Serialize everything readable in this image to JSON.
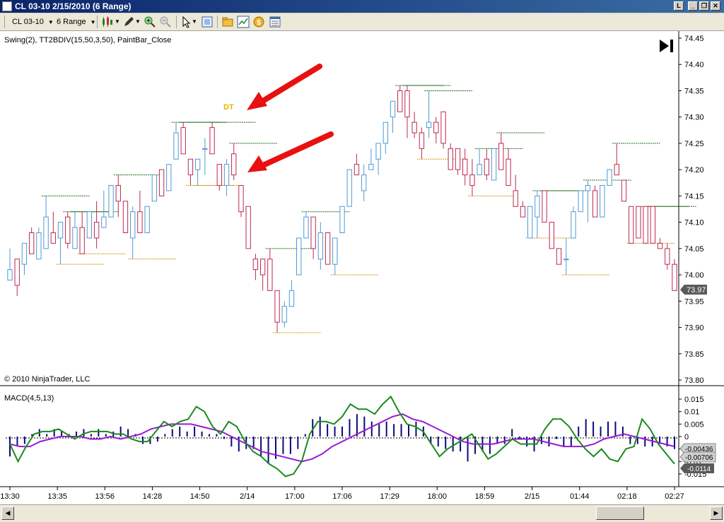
{
  "window": {
    "title": "CL 03-10  2/15/2010 (6 Range)"
  },
  "toolbar": {
    "instrument": "CL 03-10",
    "interval": "6 Range"
  },
  "chart": {
    "indicator_label": "Swing(2), TT2BDIV(15,50,3,50), PaintBar_Close",
    "signal_label": "DT",
    "copyright": "© 2010 NinjaTrader, LLC",
    "last_price": "73.97",
    "macd_label": "MACD(4,5,13)",
    "macd_values": [
      "-0.00436",
      "-0.00706",
      "-0.0114"
    ],
    "price_ticks": [
      "74.45",
      "74.40",
      "74.35",
      "74.30",
      "74.25",
      "74.20",
      "74.15",
      "74.10",
      "74.05",
      "74.00",
      "73.95",
      "73.90",
      "73.85",
      "73.80"
    ],
    "macd_ticks": [
      "0.015",
      "0.01",
      "0.005",
      "0",
      "-0.005",
      "-0.01",
      "-0.015"
    ],
    "time_ticks": [
      "13:30",
      "13:35",
      "13:56",
      "14:28",
      "14:50",
      "2/14",
      "17:00",
      "17:06",
      "17:29",
      "18:00",
      "18:59",
      "2/15",
      "01:44",
      "02:18",
      "02:27"
    ],
    "colors": {
      "up": "#4e9ad4",
      "down": "#c0284e",
      "macd": "#1a8a1a",
      "signal": "#9a1ad4",
      "hist": "#0a0a7a",
      "swing_high": "#1a6a1a",
      "swing_low": "#d49a1a",
      "arrow": "#e81010"
    }
  },
  "chart_data": [
    {
      "type": "candlestick",
      "title": "",
      "ylim": [
        73.8,
        74.45
      ],
      "candles": [
        {
          "o": 73.99,
          "h": 74.05,
          "l": 73.99,
          "c": 74.01
        },
        {
          "o": 74.03,
          "h": 74.03,
          "l": 73.96,
          "c": 73.98
        },
        {
          "o": 74.02,
          "h": 74.06,
          "l": 74.0,
          "c": 74.06
        },
        {
          "o": 74.08,
          "h": 74.09,
          "l": 74.04,
          "c": 74.04
        },
        {
          "o": 74.03,
          "h": 74.09,
          "l": 74.03,
          "c": 74.08
        },
        {
          "o": 74.05,
          "h": 74.15,
          "l": 74.1,
          "c": 74.11
        },
        {
          "o": 74.08,
          "h": 74.12,
          "l": 74.06,
          "c": 74.06
        },
        {
          "o": 74.07,
          "h": 74.1,
          "l": 74.02,
          "c": 74.1
        },
        {
          "o": 74.11,
          "h": 74.12,
          "l": 74.05,
          "c": 74.06
        },
        {
          "o": 74.05,
          "h": 74.12,
          "l": 74.05,
          "c": 74.09
        },
        {
          "o": 74.09,
          "h": 74.12,
          "l": 74.04,
          "c": 74.04
        },
        {
          "o": 74.07,
          "h": 74.12,
          "l": 74.07,
          "c": 74.12
        },
        {
          "o": 74.1,
          "h": 74.14,
          "l": 74.05,
          "c": 74.07
        },
        {
          "o": 74.09,
          "h": 74.16,
          "l": 74.09,
          "c": 74.11
        },
        {
          "o": 74.11,
          "h": 74.17,
          "l": 74.11,
          "c": 74.17
        },
        {
          "o": 74.17,
          "h": 74.19,
          "l": 74.11,
          "c": 74.14
        },
        {
          "o": 74.14,
          "h": 74.14,
          "l": 74.08,
          "c": 74.08
        },
        {
          "o": 74.07,
          "h": 74.13,
          "l": 74.03,
          "c": 74.12
        },
        {
          "o": 74.12,
          "h": 74.16,
          "l": 74.08,
          "c": 74.08
        },
        {
          "o": 74.08,
          "h": 74.13,
          "l": 74.08,
          "c": 74.13
        },
        {
          "o": 74.14,
          "h": 74.19,
          "l": 74.14,
          "c": 74.19
        },
        {
          "o": 74.2,
          "h": 74.2,
          "l": 74.15,
          "c": 74.15
        },
        {
          "o": 74.16,
          "h": 74.21,
          "l": 74.16,
          "c": 74.21
        },
        {
          "o": 74.22,
          "h": 74.29,
          "l": 74.22,
          "c": 74.27
        },
        {
          "o": 74.28,
          "h": 74.29,
          "l": 74.23,
          "c": 74.23
        },
        {
          "o": 74.22,
          "h": 74.22,
          "l": 74.17,
          "c": 74.19
        },
        {
          "o": 74.2,
          "h": 74.22,
          "l": 74.17,
          "c": 74.22
        },
        {
          "o": 74.24,
          "h": 74.26,
          "l": 74.19,
          "c": 74.24
        },
        {
          "o": 74.28,
          "h": 74.29,
          "l": 74.23,
          "c": 74.23
        },
        {
          "o": 74.21,
          "h": 74.21,
          "l": 74.16,
          "c": 74.17
        },
        {
          "o": 74.17,
          "h": 74.22,
          "l": 74.15,
          "c": 74.21
        },
        {
          "o": 74.23,
          "h": 74.25,
          "l": 74.18,
          "c": 74.19
        },
        {
          "o": 74.17,
          "h": 74.17,
          "l": 74.11,
          "c": 74.12
        },
        {
          "o": 74.13,
          "h": 74.13,
          "l": 74.07,
          "c": 74.05
        },
        {
          "o": 74.03,
          "h": 74.04,
          "l": 73.99,
          "c": 74.01
        },
        {
          "o": 74.03,
          "h": 74.03,
          "l": 73.97,
          "c": 74.0
        },
        {
          "o": 74.03,
          "h": 74.05,
          "l": 73.97,
          "c": 73.97
        },
        {
          "o": 73.97,
          "h": 73.97,
          "l": 73.89,
          "c": 73.91
        },
        {
          "o": 73.91,
          "h": 73.95,
          "l": 73.9,
          "c": 73.94
        },
        {
          "o": 73.94,
          "h": 73.99,
          "l": 73.94,
          "c": 73.97
        },
        {
          "o": 74.0,
          "h": 74.07,
          "l": 74.0,
          "c": 74.07
        },
        {
          "o": 74.07,
          "h": 74.12,
          "l": 74.07,
          "c": 74.11
        },
        {
          "o": 74.11,
          "h": 74.11,
          "l": 74.03,
          "c": 74.05
        },
        {
          "o": 74.03,
          "h": 74.1,
          "l": 74.01,
          "c": 74.08
        },
        {
          "o": 74.08,
          "h": 74.08,
          "l": 74.02,
          "c": 74.02
        },
        {
          "o": 74.02,
          "h": 74.07,
          "l": 74.0,
          "c": 74.07
        },
        {
          "o": 74.08,
          "h": 74.13,
          "l": 74.08,
          "c": 74.13
        },
        {
          "o": 74.13,
          "h": 74.2,
          "l": 74.13,
          "c": 74.2
        },
        {
          "o": 74.21,
          "h": 74.23,
          "l": 74.19,
          "c": 74.19
        },
        {
          "o": 74.16,
          "h": 74.21,
          "l": 74.14,
          "c": 74.19
        },
        {
          "o": 74.2,
          "h": 74.24,
          "l": 74.2,
          "c": 74.21
        },
        {
          "o": 74.22,
          "h": 74.25,
          "l": 74.19,
          "c": 74.25
        },
        {
          "o": 74.25,
          "h": 74.29,
          "l": 74.23,
          "c": 74.29
        },
        {
          "o": 74.3,
          "h": 74.33,
          "l": 74.27,
          "c": 74.33
        },
        {
          "o": 74.35,
          "h": 74.36,
          "l": 74.33,
          "c": 74.31
        },
        {
          "o": 74.35,
          "h": 74.36,
          "l": 74.26,
          "c": 74.3
        },
        {
          "o": 74.29,
          "h": 74.31,
          "l": 74.26,
          "c": 74.27
        },
        {
          "o": 74.27,
          "h": 74.28,
          "l": 74.22,
          "c": 74.24
        },
        {
          "o": 74.28,
          "h": 74.35,
          "l": 74.26,
          "c": 74.29
        },
        {
          "o": 74.29,
          "h": 74.3,
          "l": 74.25,
          "c": 74.27
        },
        {
          "o": 74.31,
          "h": 74.31,
          "l": 74.24,
          "c": 74.25
        },
        {
          "o": 74.24,
          "h": 74.25,
          "l": 74.2,
          "c": 74.2
        },
        {
          "o": 74.24,
          "h": 74.24,
          "l": 74.19,
          "c": 74.2
        },
        {
          "o": 74.22,
          "h": 74.24,
          "l": 74.17,
          "c": 74.19
        },
        {
          "o": 74.19,
          "h": 74.22,
          "l": 74.15,
          "c": 74.17
        },
        {
          "o": 74.19,
          "h": 74.24,
          "l": 74.19,
          "c": 74.21
        },
        {
          "o": 74.22,
          "h": 74.24,
          "l": 74.18,
          "c": 74.19
        },
        {
          "o": 74.18,
          "h": 74.24,
          "l": 74.18,
          "c": 74.24
        },
        {
          "o": 74.25,
          "h": 74.27,
          "l": 74.2,
          "c": 74.2
        },
        {
          "o": 74.22,
          "h": 74.24,
          "l": 74.17,
          "c": 74.17
        },
        {
          "o": 74.16,
          "h": 74.19,
          "l": 74.13,
          "c": 74.13
        },
        {
          "o": 74.13,
          "h": 74.14,
          "l": 74.11,
          "c": 74.11
        },
        {
          "o": 74.07,
          "h": 74.13,
          "l": 74.07,
          "c": 74.13
        },
        {
          "o": 74.11,
          "h": 74.16,
          "l": 74.07,
          "c": 74.15
        },
        {
          "o": 74.16,
          "h": 74.16,
          "l": 74.1,
          "c": 74.1
        },
        {
          "o": 74.1,
          "h": 74.1,
          "l": 74.05,
          "c": 74.05
        },
        {
          "o": 74.05,
          "h": 74.05,
          "l": 74.02,
          "c": 74.02
        },
        {
          "o": 74.03,
          "h": 74.07,
          "l": 74.0,
          "c": 74.03
        },
        {
          "o": 74.07,
          "h": 74.13,
          "l": 74.07,
          "c": 74.12
        },
        {
          "o": 74.12,
          "h": 74.16,
          "l": 74.12,
          "c": 74.16
        },
        {
          "o": 74.16,
          "h": 74.18,
          "l": 74.1,
          "c": 74.17
        },
        {
          "o": 74.16,
          "h": 74.17,
          "l": 74.11,
          "c": 74.11
        },
        {
          "o": 74.11,
          "h": 74.17,
          "l": 74.11,
          "c": 74.17
        },
        {
          "o": 74.17,
          "h": 74.2,
          "l": 74.17,
          "c": 74.2
        },
        {
          "o": 74.21,
          "h": 74.25,
          "l": 74.19,
          "c": 74.19
        },
        {
          "o": 74.18,
          "h": 74.18,
          "l": 74.15,
          "c": 74.14
        },
        {
          "o": 74.13,
          "h": 74.13,
          "l": 74.06,
          "c": 74.06
        },
        {
          "o": 74.13,
          "h": 74.13,
          "l": 74.07,
          "c": 74.07
        },
        {
          "o": 74.13,
          "h": 74.13,
          "l": 74.06,
          "c": 74.06
        },
        {
          "o": 74.13,
          "h": 74.13,
          "l": 74.06,
          "c": 74.06
        },
        {
          "o": 74.06,
          "h": 74.07,
          "l": 74.05,
          "c": 74.05
        },
        {
          "o": 74.05,
          "h": 74.06,
          "l": 74.01,
          "c": 74.02
        },
        {
          "o": 74.02,
          "h": 74.03,
          "l": 73.97,
          "c": 73.97
        }
      ]
    },
    {
      "type": "bar-line",
      "title": "MACD(4,5,13)",
      "ylim": [
        -0.017,
        0.017
      ],
      "histogram": [
        -0.008,
        -0.004,
        -0.003,
        0.001,
        0.003,
        0.001,
        0.003,
        0.002,
        0.001,
        0.002,
        0.003,
        0.001,
        0.003,
        0.001,
        0.002,
        0.004,
        0.003,
        0.001,
        -0.003,
        -0.003,
        -0.002,
        0.001,
        0.003,
        0.004,
        0.002,
        0.004,
        0.002,
        0.001,
        0.001,
        -0.001,
        -0.004,
        -0.006,
        -0.005,
        -0.005,
        -0.008,
        -0.011,
        -0.009,
        -0.007,
        -0.007,
        -0.005,
        0.001,
        0.007,
        0.008,
        0.005,
        0.004,
        0.004,
        0.007,
        0.009,
        0.008,
        0.006,
        0.005,
        0.006,
        0.005,
        0.005,
        0.005,
        0.006,
        0.004,
        -0.003,
        -0.004,
        -0.005,
        -0.006,
        -0.006,
        -0.01,
        -0.007,
        -0.006,
        -0.007,
        -0.003,
        -0.003,
        0.003,
        -0.001,
        -0.004,
        -0.006,
        -0.003,
        -0.004,
        -0.001,
        -0.004,
        -0.004,
        0.004,
        0.007,
        0.006,
        0.004,
        0.006,
        0.006,
        0.004,
        -0.003,
        -0.003,
        -0.004,
        -0.004,
        -0.003,
        -0.004,
        -0.005
      ],
      "macd": [
        -0.003,
        -0.01,
        -0.004,
        0.001,
        0.002,
        0.002,
        0.003,
        0.001,
        -0.001,
        0.001,
        0.002,
        0.002,
        0.002,
        0.001,
        0.001,
        -0.001,
        -0.002,
        -0.002,
        0.002,
        0.006,
        0.004,
        0.006,
        0.007,
        0.012,
        0.01,
        0.004,
        0.001,
        0.006,
        0.004,
        -0.002,
        -0.006,
        -0.008,
        -0.011,
        -0.013,
        -0.016,
        -0.015,
        -0.01,
        0.001,
        0.006,
        0.006,
        0.005,
        0.008,
        0.013,
        0.011,
        0.011,
        0.009,
        0.013,
        0.016,
        0.01,
        0.005,
        0.004,
        0.002,
        -0.003,
        -0.008,
        -0.005,
        -0.003,
        -0.001,
        0.001,
        -0.004,
        -0.009,
        -0.007,
        -0.004,
        -0.001,
        -0.003,
        -0.003,
        -0.003,
        0.003,
        0.007,
        0.007,
        0.004,
        -0.001,
        -0.005,
        -0.008,
        -0.005,
        -0.009,
        -0.01,
        -0.005,
        -0.004,
        0.007,
        0.003,
        -0.003,
        -0.007,
        -0.011
      ],
      "signal": [
        -0.003,
        -0.004,
        -0.004,
        -0.002,
        -0.001,
        0.0,
        0.0,
        0.0,
        -0.001,
        -0.001,
        0.0,
        -0.001,
        0.0,
        0.001,
        0.003,
        0.004,
        0.005,
        0.005,
        0.005,
        0.004,
        0.003,
        0.002,
        0.0,
        -0.002,
        -0.004,
        -0.006,
        -0.007,
        -0.008,
        -0.009,
        -0.01,
        -0.009,
        -0.007,
        -0.004,
        -0.002,
        0.0,
        0.002,
        0.004,
        0.006,
        0.008,
        0.009,
        0.007,
        0.006,
        0.004,
        0.002,
        0.0,
        -0.002,
        -0.003,
        -0.003,
        -0.003,
        -0.002,
        -0.001,
        -0.001,
        -0.001,
        -0.002,
        -0.003,
        -0.004,
        -0.004,
        -0.004,
        -0.003,
        -0.001,
        0.0,
        0.001,
        0.0,
        -0.001,
        -0.002,
        -0.003,
        -0.004
      ]
    }
  ]
}
